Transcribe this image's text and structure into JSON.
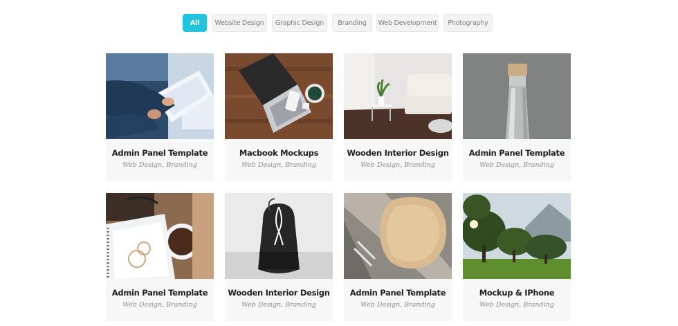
{
  "filters": [
    {
      "label": "All",
      "active": true
    },
    {
      "label": "Website Design",
      "active": false
    },
    {
      "label": "Graphic Design",
      "active": false
    },
    {
      "label": "Branding",
      "active": false
    },
    {
      "label": "Web Development",
      "active": false
    },
    {
      "label": "Photography",
      "active": false
    }
  ],
  "accent_color": "#22c3dc",
  "portfolio": [
    {
      "title": "Admin Panel Template",
      "tags": "Web Design, Branding",
      "image": "tablet-hands-photo"
    },
    {
      "title": "Macbook Mockups",
      "tags": "Web Design, Branding",
      "image": "laptop-desk-photo"
    },
    {
      "title": "Wooden Interior Design",
      "tags": "Web Design, Branding",
      "image": "living-room-photo"
    },
    {
      "title": "Admin Panel Template",
      "tags": "Web Design, Branding",
      "image": "glass-bottle-photo"
    },
    {
      "title": "Admin Panel Template",
      "tags": "Web Design, Branding",
      "image": "coffee-notebook-photo"
    },
    {
      "title": "Wooden Interior Design",
      "tags": "Web Design, Branding",
      "image": "backpack-photo"
    },
    {
      "title": "Admin Panel Template",
      "tags": "Web Design, Branding",
      "image": "wooden-sign-photo"
    },
    {
      "title": "Mockup & IPhone",
      "tags": "Web Design, Branding",
      "image": "park-trees-photo"
    }
  ]
}
